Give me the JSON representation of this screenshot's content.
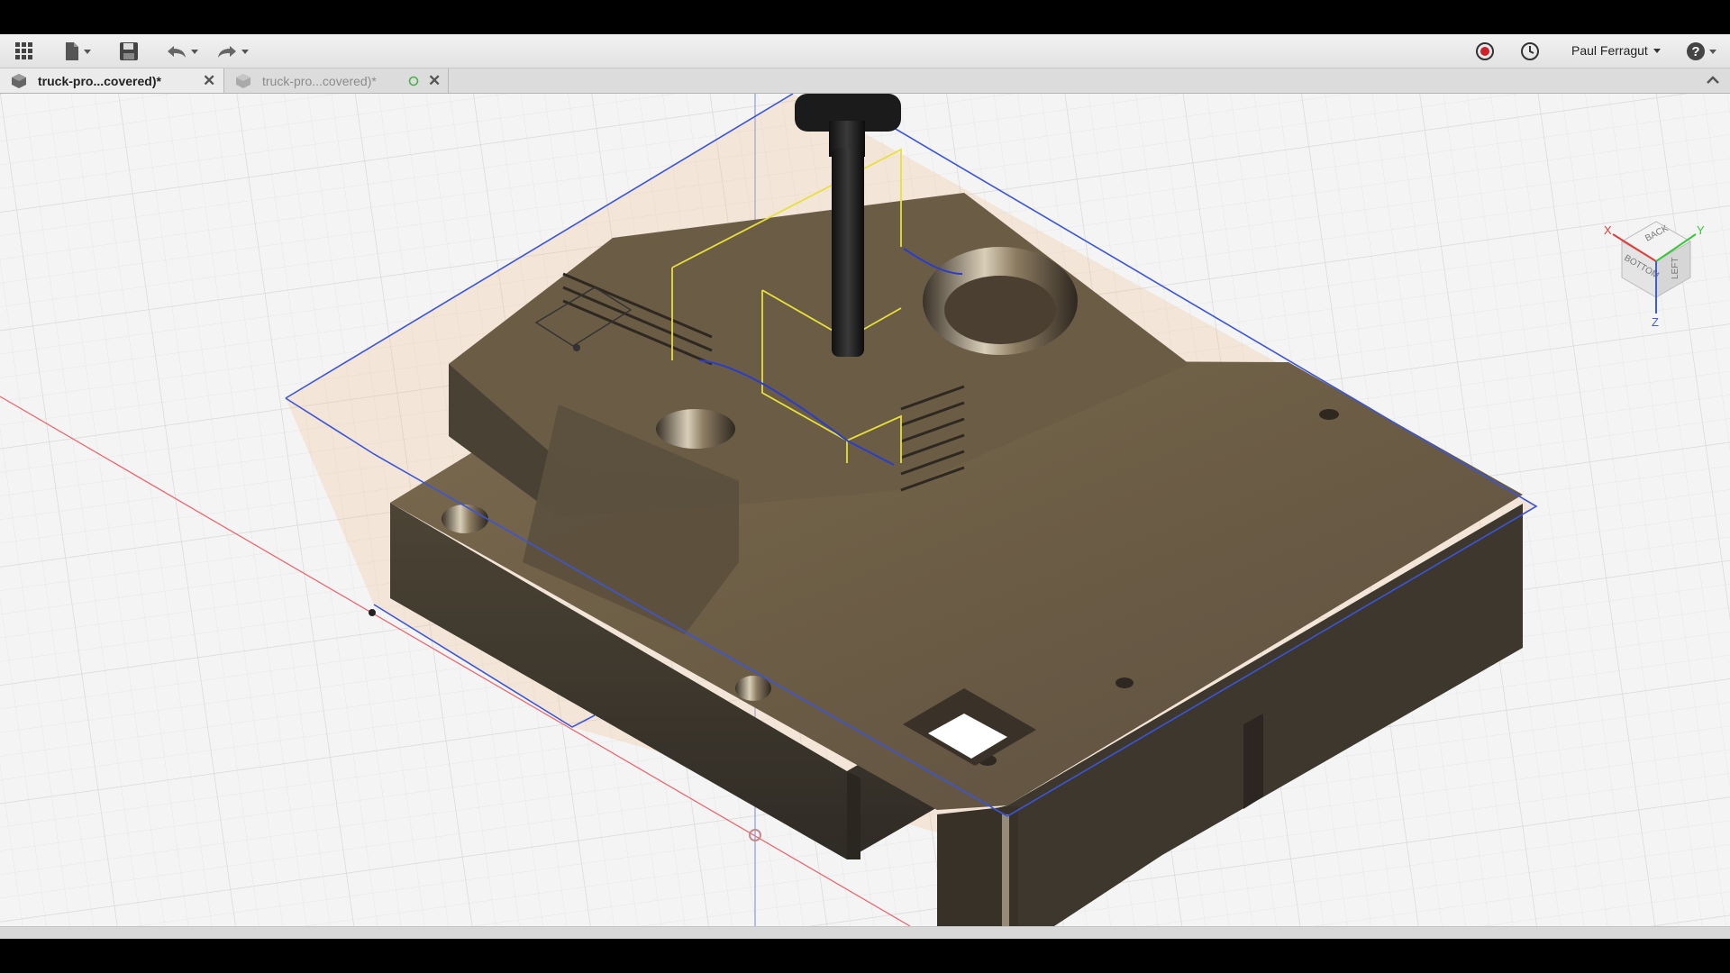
{
  "toolbar": {
    "apps_icon": "grid-icon",
    "file_icon": "file-icon",
    "save_icon": "save-icon",
    "undo_icon": "undo-icon",
    "redo_icon": "redo-icon",
    "record_icon": "record-icon",
    "history_icon": "clock-icon",
    "user_name": "Paul Ferragut",
    "help_icon": "help-icon"
  },
  "tabs": [
    {
      "label": "truck-pro...covered)*",
      "active": true
    },
    {
      "label": "truck-pro...covered)*",
      "active": false
    }
  ],
  "viewcube": {
    "faces": [
      "BACK",
      "BOTTOM",
      "LEFT"
    ],
    "axes": {
      "x": "X",
      "y": "Y",
      "z": "Z"
    },
    "colors": {
      "x": "#e03c3c",
      "y": "#3cc63c",
      "z": "#3c5ce0"
    }
  },
  "colors": {
    "part": "#5f5342",
    "stock_plane": "#3b55d8",
    "toolpath": "#e8e03a",
    "origin_x_axis": "#e86a72",
    "record": "#d0202a"
  }
}
